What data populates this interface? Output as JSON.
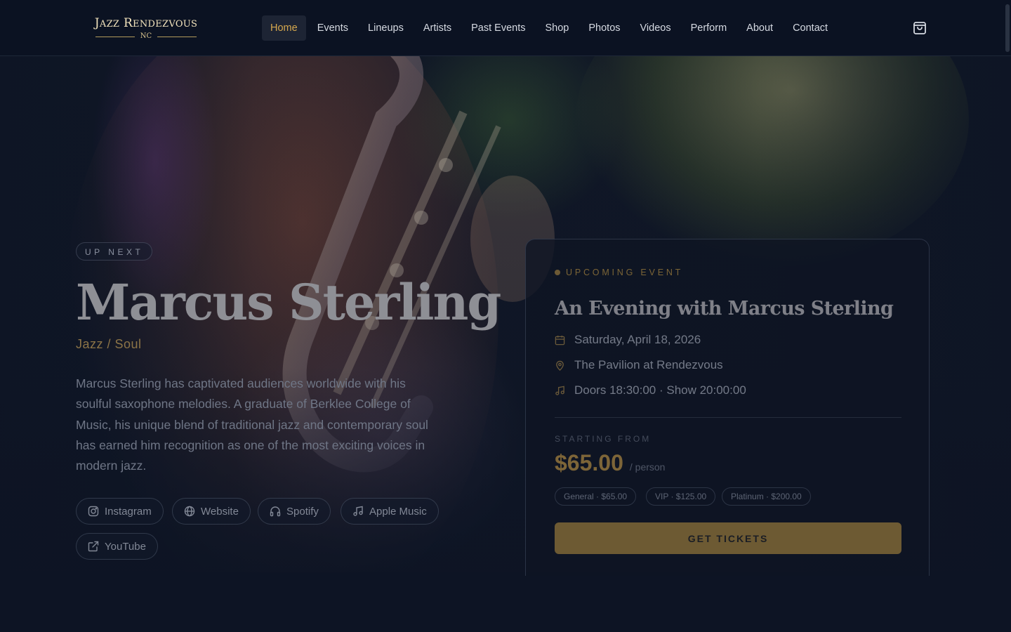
{
  "brand": {
    "name": "Jazz Rendezvous",
    "sub": "NC"
  },
  "nav": {
    "items": [
      "Home",
      "Events",
      "Lineups",
      "Artists",
      "Past Events",
      "Shop",
      "Photos",
      "Videos",
      "Perform",
      "About",
      "Contact"
    ],
    "active": "Home"
  },
  "hero": {
    "badge": "UP NEXT",
    "artist": "Marcus Sterling",
    "genre": "Jazz / Soul",
    "bio": "Marcus Sterling has captivated audiences worldwide with his soulful saxophone melodies. A graduate of Berklee College of Music, his unique blend of traditional jazz and contemporary soul has earned him recognition as one of the most exciting voices in modern jazz.",
    "links": [
      {
        "label": "Instagram",
        "icon": "instagram-icon"
      },
      {
        "label": "Website",
        "icon": "globe-icon"
      },
      {
        "label": "Spotify",
        "icon": "headphones-icon"
      },
      {
        "label": "Apple Music",
        "icon": "music-note-icon"
      },
      {
        "label": "YouTube",
        "icon": "external-link-icon"
      }
    ]
  },
  "event": {
    "tag": "UPCOMING EVENT",
    "title": "An Evening with Marcus Sterling",
    "date": "Saturday, April 18, 2026",
    "venue": "The Pavilion at Rendezvous",
    "times": "Doors 18:30:00 · Show 20:00:00",
    "starting_label": "STARTING FROM",
    "price": "$65.00",
    "per": "/ person",
    "tiers": [
      "General · $65.00",
      "VIP · $125.00",
      "Platinum · $200.00"
    ],
    "cta": "GET TICKETS"
  },
  "colors": {
    "accent": "#d6a84e",
    "background": "#0d1424"
  }
}
